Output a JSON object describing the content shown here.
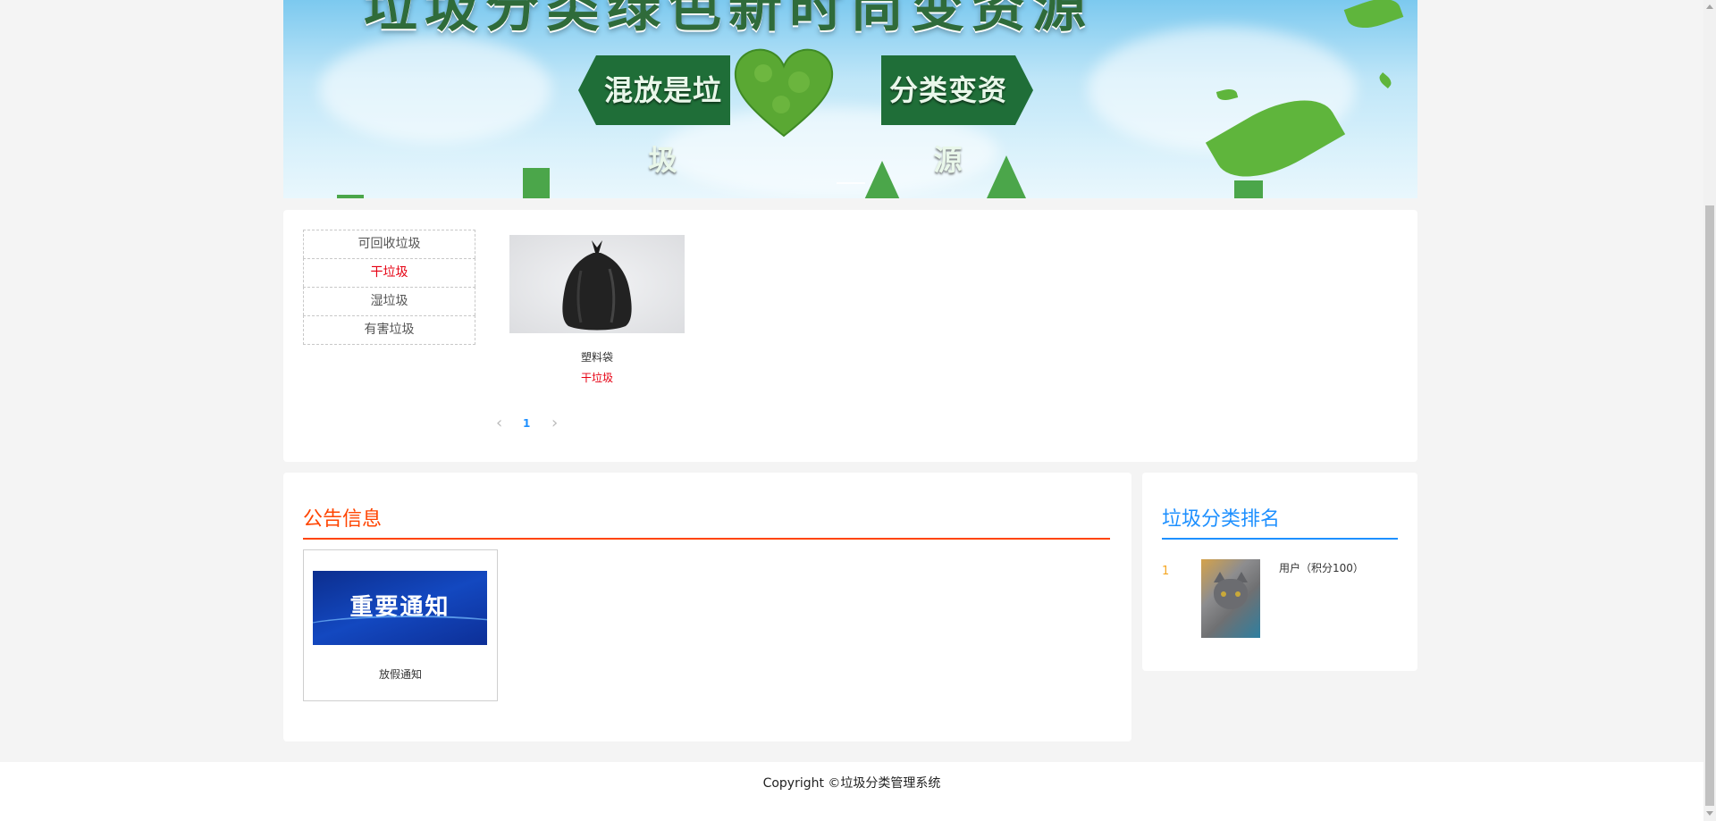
{
  "banner": {
    "headline": "垃圾分类绿色新时尚变资源",
    "slogan_left": "混放是垃圾",
    "slogan_right": "分类变资源"
  },
  "categories": {
    "items": [
      "可回收垃圾",
      "干垃圾",
      "湿垃圾",
      "有害垃圾"
    ],
    "active_index": 1
  },
  "products": [
    {
      "name": "塑料袋",
      "category": "干垃圾",
      "image_icon": "black-garbage-bag"
    }
  ],
  "pagination": {
    "prev": "‹",
    "current": "1",
    "next": "›"
  },
  "notices": {
    "title": "公告信息",
    "accent": "#ff4400",
    "items": [
      {
        "image_text": "重要通知",
        "title": "放假通知"
      }
    ]
  },
  "ranking": {
    "title": "垃圾分类排名",
    "accent": "#1e90ff",
    "items": [
      {
        "rank": "1",
        "label": "用户（积分100）",
        "avatar_icon": "cat-avatar"
      }
    ]
  },
  "footer": {
    "copyright": "Copyright ©垃圾分类管理系统"
  },
  "colors": {
    "active_red": "#e60012",
    "link_blue": "#1e90ff",
    "rank_gold": "#f5a623"
  }
}
